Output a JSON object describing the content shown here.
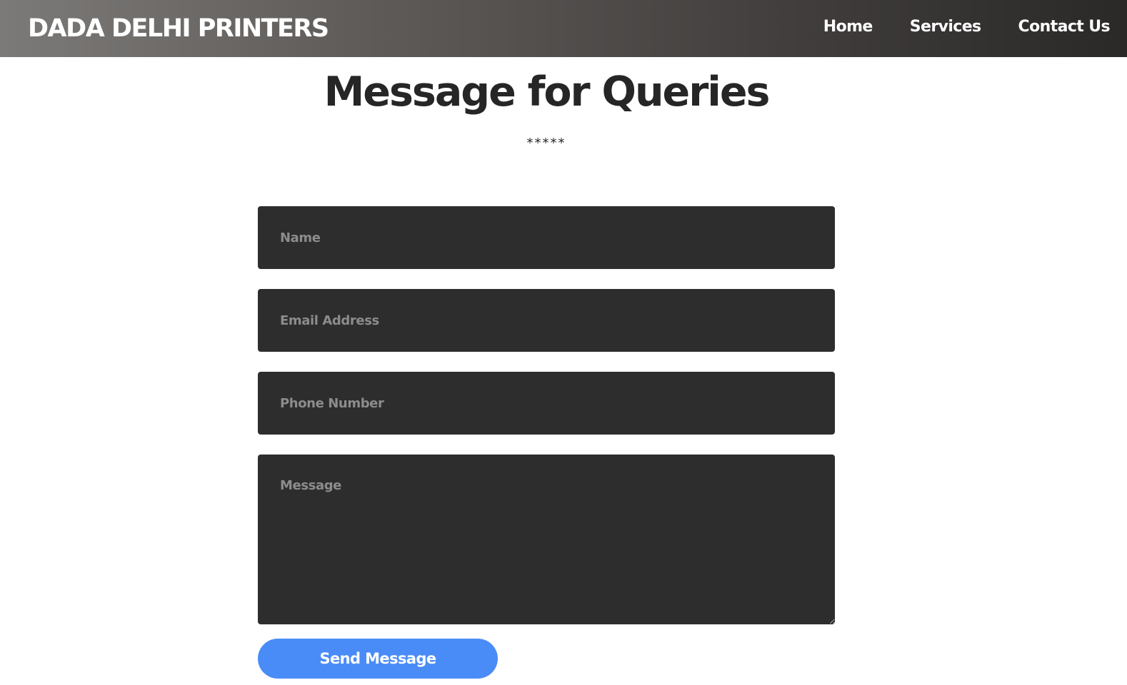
{
  "header": {
    "brand": "DADA DELHI PRINTERS",
    "nav": [
      {
        "label": "Home"
      },
      {
        "label": "Services"
      },
      {
        "label": "Contact Us"
      }
    ]
  },
  "main": {
    "title": "Message for Queries",
    "divider": "*****",
    "form": {
      "name_placeholder": "Name",
      "email_placeholder": "Email Address",
      "phone_placeholder": "Phone Number",
      "message_placeholder": "Message",
      "submit_label": "Send Message"
    }
  },
  "colors": {
    "navbar_start": "#7c7a78",
    "navbar_end": "#2a2928",
    "field_background": "#2d2d2d",
    "button": "#4a8cf7",
    "title_text": "#262626"
  }
}
